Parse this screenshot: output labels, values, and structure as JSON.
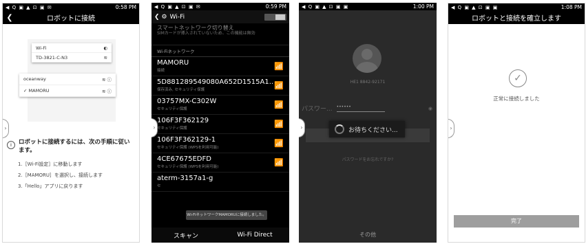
{
  "screen1": {
    "status_icons": "◀ Q ▣ ▲ ⊡ ▣ ✉",
    "status_right": "⁂ ⅋ ⊘ ▮",
    "time": "0:58 PM",
    "title": "ロボットに接続",
    "wifi_label": "Wi-Fi",
    "ssid_a": "TD-3821-C-N3",
    "network_1": "oceanway",
    "network_2": "MAMORU",
    "instruction": "ロボットに接続するには、次の手順に従います。",
    "steps": [
      "1.［Wi-Fi設定］に移動します",
      "2.［MAMORU］を選択し、接続します",
      "3.「Hello」アプリに戻ります"
    ]
  },
  "screen2": {
    "status_icons": "◀ Q ▣ ▲ ⊡ ▣ ✉",
    "status_right": "⁂ ⅋ ⊘ ▮",
    "time": "0:59 PM",
    "title": "Wi-Fi",
    "smart_switch": "スマートネットワーク切り替え",
    "smart_switch_desc": "SIMカードが挿入されていないため、この機能は無効",
    "section": "Wi-Fiネットワーク",
    "networks": [
      {
        "name": "MAMORU",
        "status": "接続"
      },
      {
        "name": "5D881289549080A652D1515A1...",
        "status": "保存済み, セキュリティ保護"
      },
      {
        "name": "03757MX-C302W",
        "status": "セキュリティ保護"
      },
      {
        "name": "106F3F362129",
        "status": "セキュリティ保護"
      },
      {
        "name": "106F3F362129-1",
        "status": "セキュリティ保護 (WPSを利用可能)"
      },
      {
        "name": "4CE67675EDFD",
        "status": "セキュリティ保護 (WPSを利用可能)"
      },
      {
        "name": "aterm-3157a1-g",
        "status": "セ"
      }
    ],
    "toast": "Wi-FiネットワークMAMORUに接続しました。",
    "scan_label": "スキャン",
    "direct_label": "Wi-Fi Direct"
  },
  "screen3": {
    "status_icons": "◀ Q ▣ ▲ ⊡ ▣ ▣",
    "status_right": "⁂ ⅋ ⊘ ▮",
    "time": "1:00 PM",
    "robot_id": "HE1 8842-92171",
    "password_label": "パスワー...",
    "password_value": "••••••",
    "forgot_link": "パスワードをお忘れですか?",
    "loading_text": "お待ちください...",
    "other_label": "その他"
  },
  "screen4": {
    "status_icons": "◀ Q ▣ ▲ ⊡ ▣ ▣",
    "status_right": "⁂ ⊘ ▮",
    "time": "1:08 PM",
    "title": "ロボットと接続を確立します",
    "message": "正常に接続しました",
    "done_label": "完了"
  }
}
